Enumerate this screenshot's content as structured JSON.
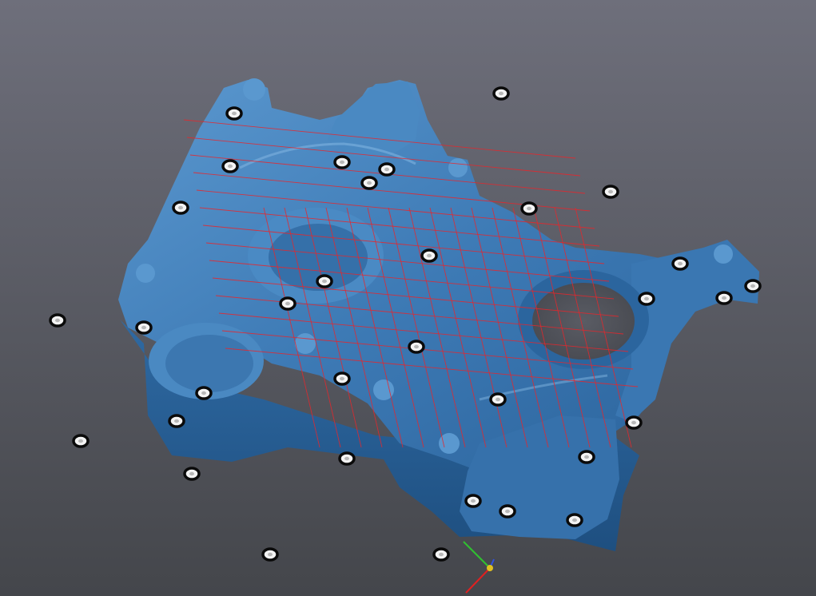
{
  "viewport": {
    "background_top": "#6e6f7b",
    "background_bottom": "#44464b",
    "mesh_color": "#3d7ab5",
    "mesh_light": "#5b98cf",
    "mesh_dark": "#1e4f80",
    "scanline_color": "#e8262b",
    "marker_count": 33
  },
  "axis_gizmo": {
    "icon": "xyz-axis-triad-icon",
    "colors": {
      "x": "#e02020",
      "y": "#30c030",
      "z": "#3050e0",
      "origin": "#e0c020"
    }
  }
}
